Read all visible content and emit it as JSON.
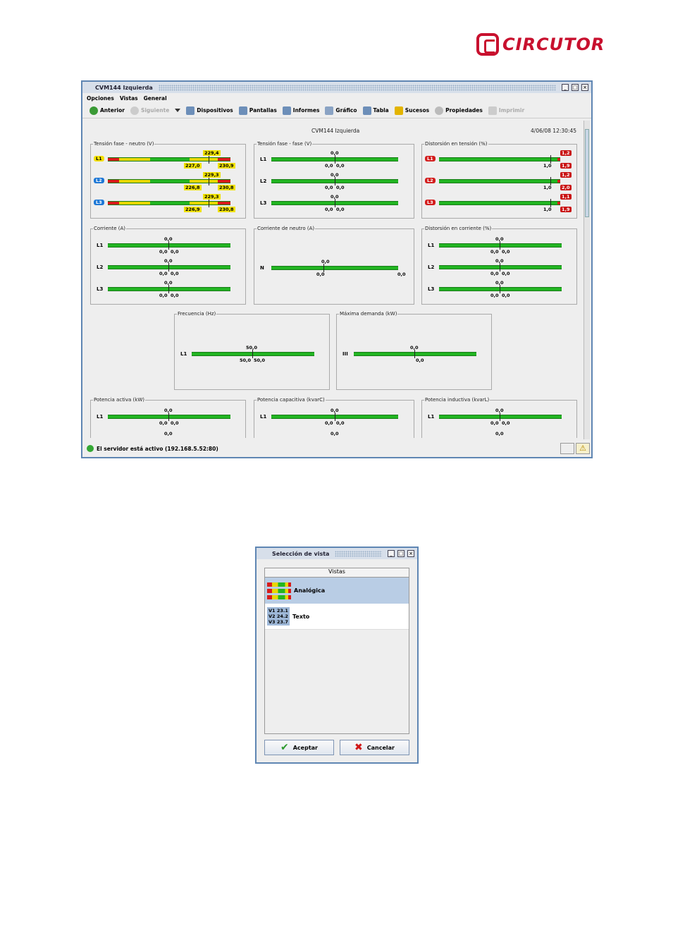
{
  "brand": {
    "logo_text": "CIRCUTOR"
  },
  "window": {
    "title": "CVM144 Izquierda"
  },
  "menu": [
    "Opciones",
    "Vistas",
    "General"
  ],
  "toolbar": [
    {
      "label": "Anterior",
      "icon": "back-arrow-icon",
      "enabled": true
    },
    {
      "label": "Siguiente",
      "icon": "forward-arrow-icon",
      "enabled": false
    },
    {
      "label": "Dispositivos",
      "icon": "device-icon",
      "enabled": true
    },
    {
      "label": "Pantallas",
      "icon": "screen-icon",
      "enabled": true
    },
    {
      "label": "Informes",
      "icon": "report-icon",
      "enabled": true
    },
    {
      "label": "Gráfico",
      "icon": "chart-icon",
      "enabled": true
    },
    {
      "label": "Tabla",
      "icon": "table-icon",
      "enabled": true
    },
    {
      "label": "Sucesos",
      "icon": "events-icon",
      "enabled": true
    },
    {
      "label": "Propiedades",
      "icon": "properties-icon",
      "enabled": true
    },
    {
      "label": "Imprimir",
      "icon": "print-icon",
      "enabled": false
    }
  ],
  "header": {
    "device": "CVM144 Izquierda",
    "datetime": "4/06/08 12:30:45"
  },
  "panels": {
    "tension_fn": {
      "title": "Tensión fase - neutro (V)",
      "rows": [
        {
          "label": "L1",
          "value": "229,4",
          "min": "227,0",
          "max": "230,9"
        },
        {
          "label": "L2",
          "value": "229,3",
          "min": "226,8",
          "max": "230,8"
        },
        {
          "label": "L3",
          "value": "229,3",
          "min": "226,9",
          "max": "230,8"
        }
      ]
    },
    "tension_ff": {
      "title": "Tensión fase - fase (V)",
      "rows": [
        {
          "label": "L1",
          "value": "0,0",
          "min": "0,0",
          "max": "0,0"
        },
        {
          "label": "L2",
          "value": "0,0",
          "min": "0,0",
          "max": "0,0"
        },
        {
          "label": "L3",
          "value": "0,0",
          "min": "0,0",
          "max": "0,0"
        }
      ]
    },
    "dist_tension": {
      "title": "Distorsión en tensión (%)",
      "rows": [
        {
          "label": "L1",
          "value": "1,0",
          "top": "1,2",
          "bottom": "1,9"
        },
        {
          "label": "L2",
          "value": "1,0",
          "top": "1,2",
          "bottom": "2,0"
        },
        {
          "label": "L3",
          "value": "1,0",
          "top": "1,1",
          "bottom": "1,9"
        }
      ]
    },
    "corriente": {
      "title": "Corriente (A)",
      "rows": [
        {
          "label": "L1",
          "value": "0,0",
          "min": "0,0",
          "max": "0,0"
        },
        {
          "label": "L2",
          "value": "0,0",
          "min": "0,0",
          "max": "0,0"
        },
        {
          "label": "L3",
          "value": "0,0",
          "min": "0,0",
          "max": "0,0"
        }
      ]
    },
    "corr_neutro": {
      "title": "Corriente de neutro (A)",
      "rows": [
        {
          "label": "N",
          "value": "0,0",
          "min": "0,0",
          "max": "0,0"
        }
      ]
    },
    "dist_corriente": {
      "title": "Distorsión en corriente (%)",
      "rows": [
        {
          "label": "L1",
          "value": "0,0",
          "min": "0,0",
          "max": "0,0"
        },
        {
          "label": "L2",
          "value": "0,0",
          "min": "0,0",
          "max": "0,0"
        },
        {
          "label": "L3",
          "value": "0,0",
          "min": "0,0",
          "max": "0,0"
        }
      ]
    },
    "frecuencia": {
      "title": "Frecuencia (Hz)",
      "rows": [
        {
          "label": "L1",
          "value": "50,0",
          "min": "50,0",
          "max": "50,0"
        }
      ]
    },
    "max_demanda": {
      "title": "Máxima demanda (kW)",
      "rows": [
        {
          "label": "III",
          "value": "0,0",
          "min": "0,0"
        }
      ]
    },
    "pot_activa": {
      "title": "Potencia activa (kW)",
      "rows": [
        {
          "label": "L1",
          "value": "0,0",
          "min": "0,0",
          "max": "0,0",
          "next": "0,0"
        }
      ]
    },
    "pot_capacitiva": {
      "title": "Potencia capacitiva (kvarC)",
      "rows": [
        {
          "label": "L1",
          "value": "0,0",
          "min": "0,0",
          "max": "0,0",
          "next": "0,0"
        }
      ]
    },
    "pot_inductiva": {
      "title": "Potencia inductiva (kvarL)",
      "rows": [
        {
          "label": "L1",
          "value": "0,0",
          "min": "0,0",
          "max": "0,0",
          "next": "0,0"
        }
      ]
    }
  },
  "status": {
    "text": "El servidor está activo (192.168.5.52:80)"
  },
  "dialog": {
    "title": "Selección de vista",
    "list_header": "Vistas",
    "items": [
      {
        "label": "Analógica",
        "selected": true
      },
      {
        "label": "Texto",
        "selected": false
      }
    ],
    "text_icon": [
      "V1 23.1",
      "V2 24.2",
      "V3 23.7"
    ],
    "ok": "Aceptar",
    "cancel": "Cancelar"
  }
}
